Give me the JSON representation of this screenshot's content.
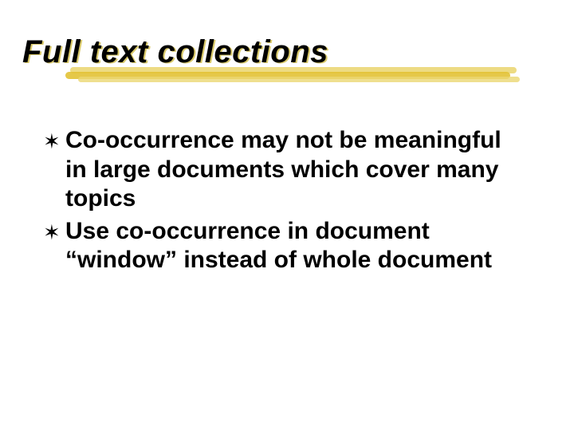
{
  "slide": {
    "title": "Full text collections",
    "bullets": [
      "Co-occurrence may not be meaningful in large documents which cover many topics",
      "Use co-occurrence in document “window” instead of whole document"
    ],
    "bullet_marker": "✶"
  }
}
